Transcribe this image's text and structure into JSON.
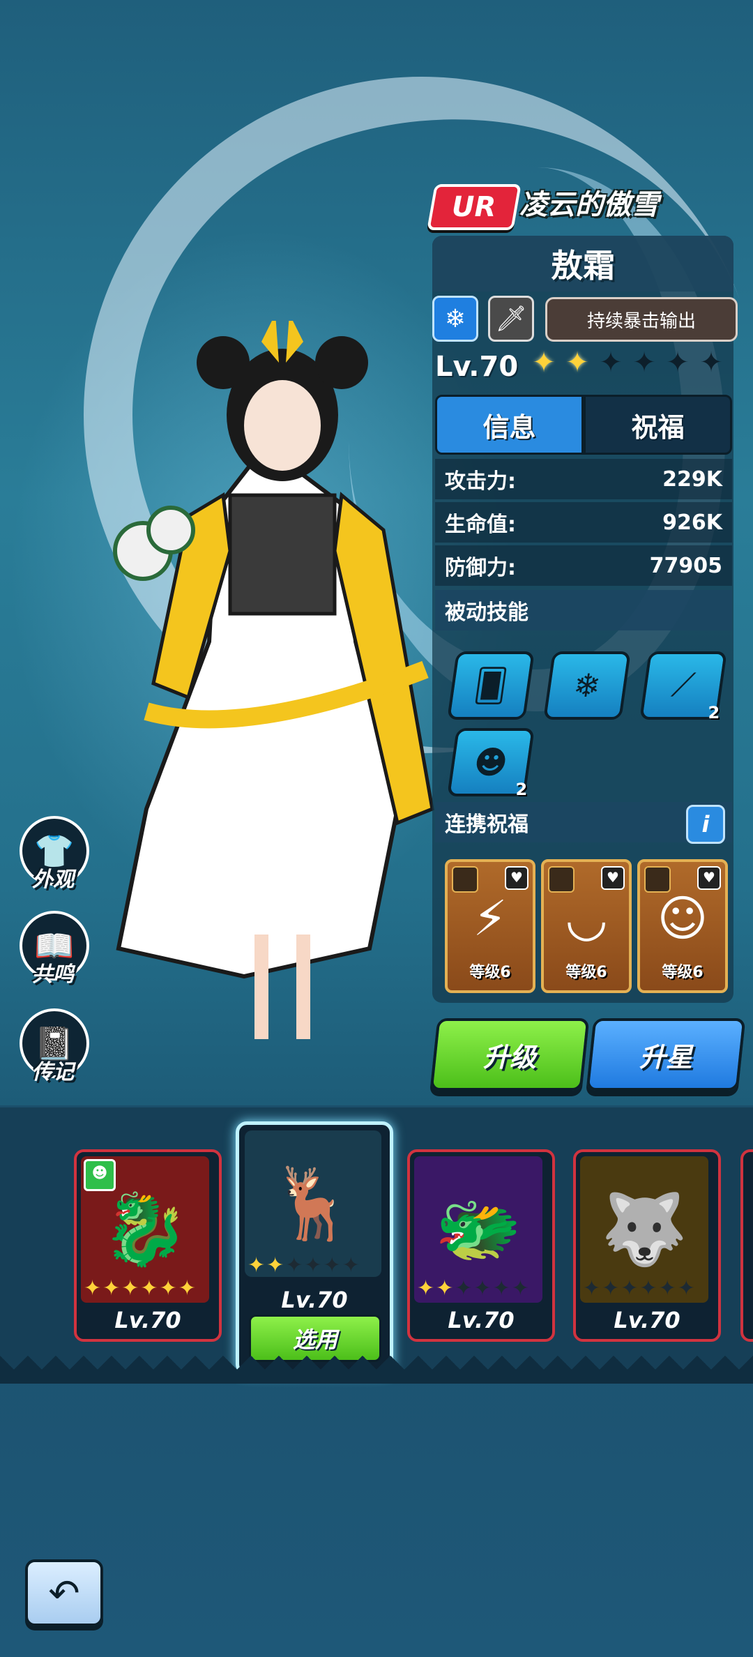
{
  "hero": {
    "rarity": "UR",
    "title": "凌云的傲雪",
    "name": "敖霜",
    "element_icon": "snowflake-icon",
    "weapon_icon": "sword-icon",
    "role": "持续暴击输出",
    "level": "Lv.70",
    "stars": {
      "filled": 2,
      "total": 6
    }
  },
  "tabs": [
    {
      "label": "信息",
      "active": true
    },
    {
      "label": "祝福",
      "active": false
    }
  ],
  "stats": [
    {
      "label": "攻击力:",
      "value": "229K"
    },
    {
      "label": "生命值:",
      "value": "926K"
    },
    {
      "label": "防御力:",
      "value": "77905"
    }
  ],
  "passive": {
    "header": "被动技能",
    "skills": [
      {
        "icon": "cards-icon",
        "count": ""
      },
      {
        "icon": "snowflake-icon",
        "count": ""
      },
      {
        "icon": "slash-icon",
        "count": "2"
      },
      {
        "icon": "demon-icon",
        "count": "2"
      }
    ]
  },
  "link_blessing": {
    "header": "连携祝福",
    "info_label": "i",
    "items": [
      {
        "icon": "gold-bars-icon",
        "level_label": "等级6"
      },
      {
        "icon": "fang-necklace-icon",
        "level_label": "等级6"
      },
      {
        "icon": "mask-icon",
        "level_label": "等级6"
      }
    ]
  },
  "actions": {
    "upgrade": "升级",
    "star_up": "升星"
  },
  "side_menu": [
    {
      "icon": "shirt-icon",
      "label": "外观"
    },
    {
      "icon": "book-icon",
      "label": "共鸣"
    },
    {
      "icon": "journal-icon",
      "label": "传记"
    }
  ],
  "roster": [
    {
      "name": "red-dragon",
      "level": "Lv.70",
      "stars": 6,
      "selected": false
    },
    {
      "name": "white-stag",
      "level": "Lv.70",
      "stars": 2,
      "selected": true,
      "select_label": "选用"
    },
    {
      "name": "purple-dragon",
      "level": "Lv.70",
      "stars": 2,
      "selected": false
    },
    {
      "name": "golden-beast",
      "level": "Lv.70",
      "stars": 0,
      "selected": false
    }
  ],
  "colors": {
    "accent_blue": "#2a8be0",
    "upgrade_green": "#4cbf1a",
    "rarity_red": "#e3243a",
    "star_gold": "#ffd23a"
  }
}
